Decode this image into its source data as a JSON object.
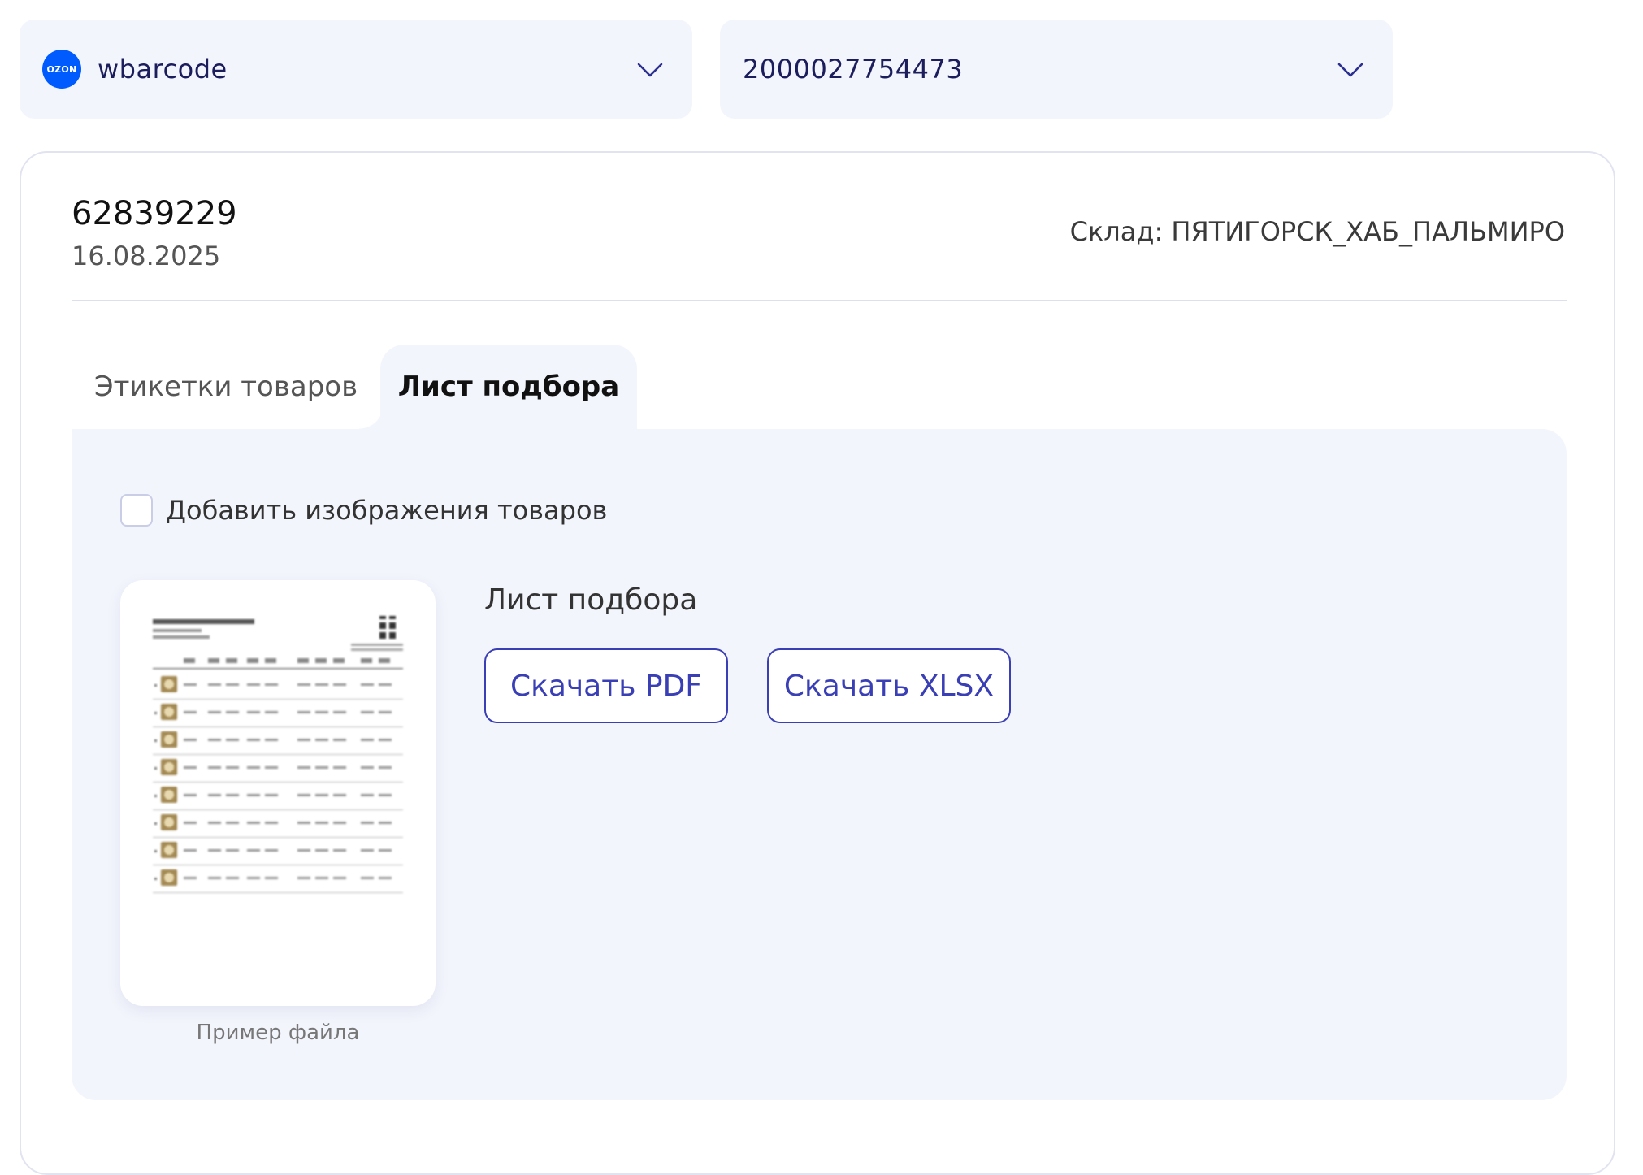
{
  "account_select": {
    "logo_text": "OZON",
    "value": "wbarcode"
  },
  "shipment_select": {
    "value": "2000027754473"
  },
  "order": {
    "id": "62839229",
    "date": "16.08.2025",
    "warehouse": "Склад: ПЯТИГОРСК_ХАБ_ПАЛЬМИРО"
  },
  "tabs": [
    {
      "label": "Этикетки товаров",
      "active": false
    },
    {
      "label": "Лист подбора",
      "active": true
    }
  ],
  "options": {
    "add_images_label": "Добавить изображения товаров",
    "add_images_checked": false
  },
  "preview": {
    "caption": "Пример файла",
    "row_count": 8
  },
  "picklist": {
    "title": "Лист подбора",
    "download_pdf": "Скачать PDF",
    "download_xlsx": "Скачать XLSX"
  },
  "colors": {
    "accent": "#3a3fb5",
    "ozon_blue": "#005bff",
    "panel_bg": "#f3f5fd"
  },
  "icons": {
    "select_toggle": "chevron-down-icon"
  }
}
